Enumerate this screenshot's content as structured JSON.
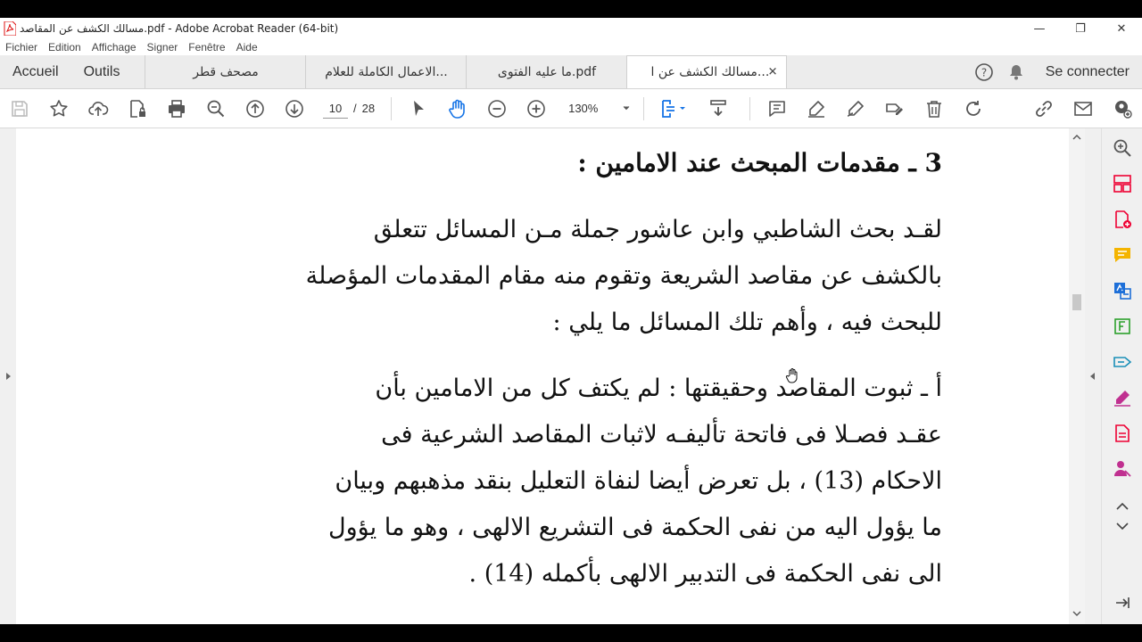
{
  "window": {
    "title": "مسالك الكشف عن المقاصد.pdf - Adobe Acrobat Reader (64-bit)",
    "controls": {
      "minimize": "—",
      "restore": "❐",
      "close": "✕"
    }
  },
  "menu": [
    "Fichier",
    "Edition",
    "Affichage",
    "Signer",
    "Fenêtre",
    "Aide"
  ],
  "tabs": {
    "home": "Accueil",
    "tools": "Outils",
    "documents": [
      {
        "label": "مصحف قطر",
        "active": false
      },
      {
        "label": "الاعمال الكاملة للعلام...",
        "active": false
      },
      {
        "label": "ما عليه الفتوى.pdf",
        "active": false
      },
      {
        "label": "مسالك الكشف عن ا...",
        "active": true
      }
    ],
    "close_glyph": "✕",
    "sign_in": "Se connecter"
  },
  "toolbar": {
    "current_page": "10",
    "separator": "/",
    "total_pages": "28",
    "zoom": "130%"
  },
  "document": {
    "heading": "3 ـ مقدمات المبحث عند الامامين :",
    "paragraph1": [
      "لقـد بحث الشاطبي وابن عاشور جملة مـن المسائل تتعلق",
      "بالكشف عن مقاصد الشريعة وتقوم منه مقام المقدمات المؤصلة",
      "للبحث فيه ، وأهم تلك المسائل ما يلي :"
    ],
    "paragraph2": [
      "أ ـ ثبوت المقاصد وحقيقتها : لم يكتف كل من الامامين بأن",
      "عقـد فصـلا فى فاتحة تأليفـه لاثبات المقاصد الشرعية فى",
      "الاحكام (13) ، بل تعرض أيضا لنفاة التعليل بنقد مذهبهم وبيان",
      "ما يؤول اليه من نفى الحكمة فى التشريع الالهى ، وهو ما يؤول",
      "الى نفى الحكمة فى التدبير الالهى بأكمله (14) ."
    ]
  },
  "colors": {
    "accent": "#1473e6",
    "icon": "#555555",
    "tab_bg": "#ececec"
  }
}
